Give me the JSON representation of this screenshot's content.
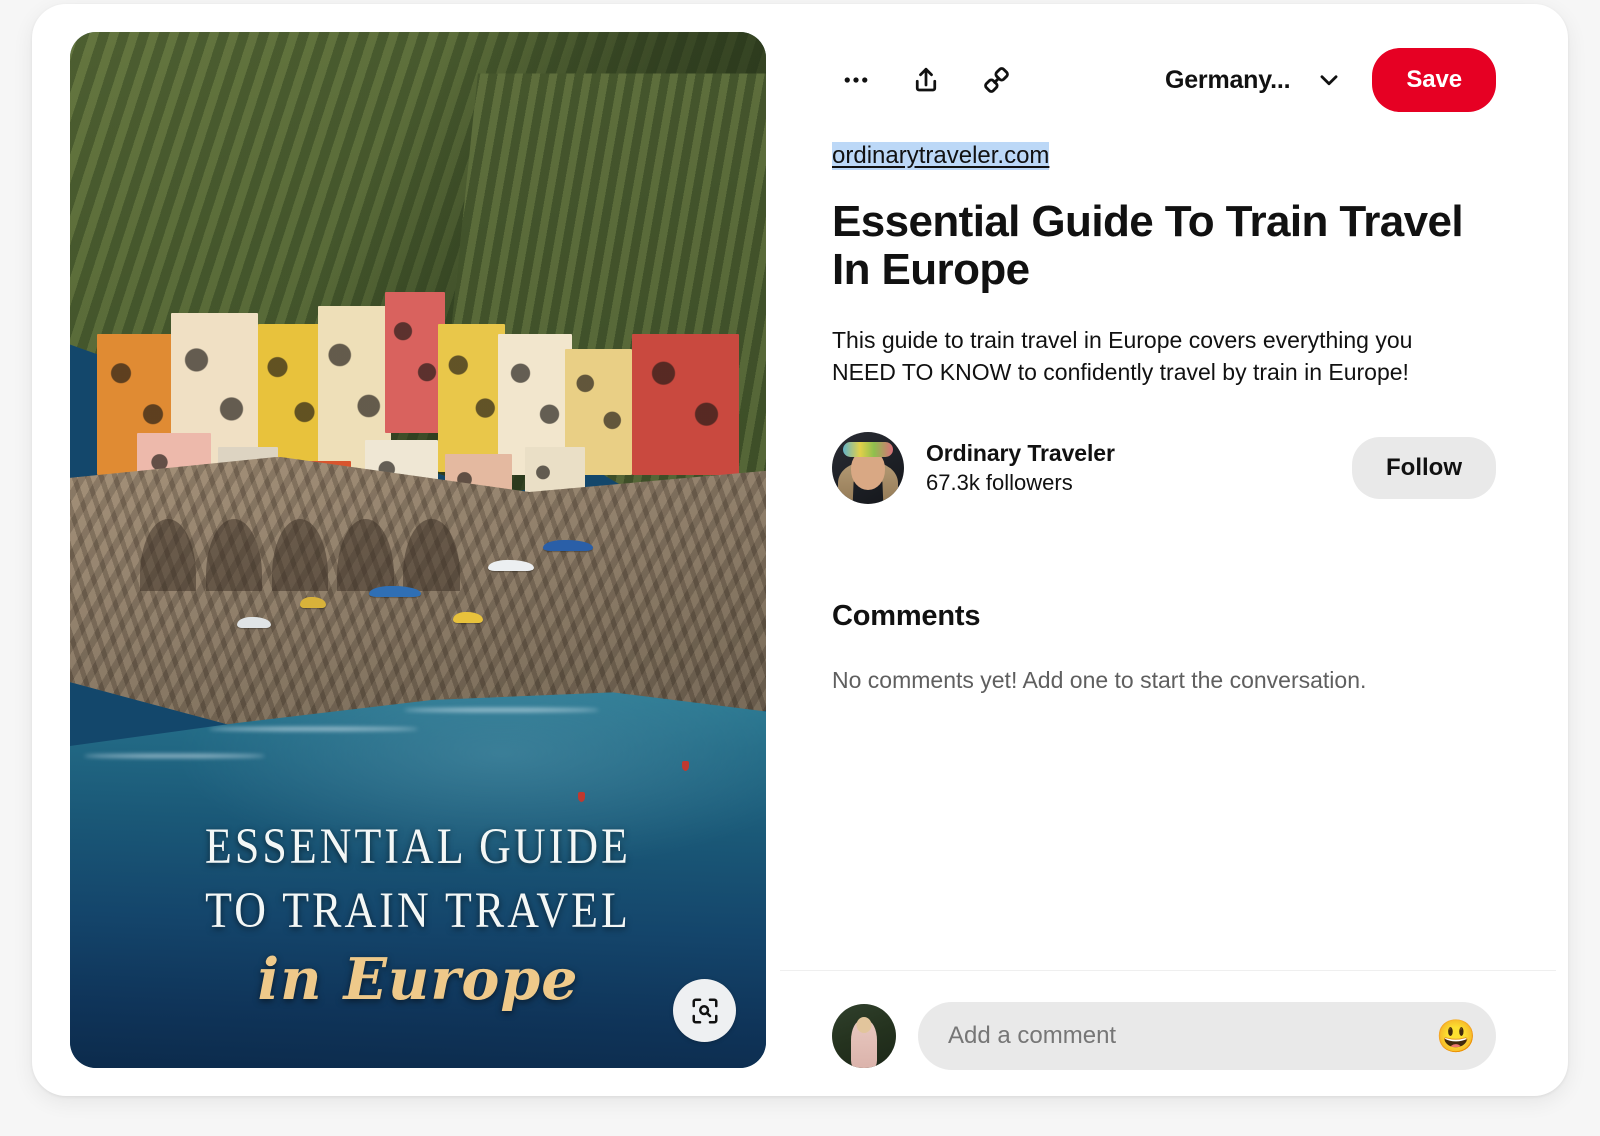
{
  "pin": {
    "source_url": "ordinarytraveler.com",
    "title": "Essential Guide To Train Travel In Europe",
    "description": "This guide to train travel in Europe covers everything you NEED TO KNOW to confidently travel by train in Europe!",
    "image_overlay": {
      "line1": "ESSENTIAL GUIDE",
      "line2": "TO TRAIN TRAVEL",
      "line3": "in Europe"
    }
  },
  "actions": {
    "more_options_icon": "ellipsis-icon",
    "share_icon": "share-upload-icon",
    "link_icon": "chain-link-icon",
    "board_name": "Germany...",
    "board_chevron_icon": "chevron-down-icon",
    "save_label": "Save",
    "save_color": "#e60023",
    "visual_search_icon": "lens-search-icon"
  },
  "author": {
    "name": "Ordinary Traveler",
    "followers": "67.3k followers",
    "follow_label": "Follow",
    "avatar_name": "author-avatar"
  },
  "comments": {
    "heading": "Comments",
    "empty_text": "No comments yet! Add one to start the conversation.",
    "composer": {
      "placeholder": "Add a comment",
      "value": "",
      "emoji_icon": "grinning-face-emoji",
      "emoji_glyph": "😃",
      "avatar_name": "current-user-avatar"
    }
  },
  "theme": {
    "page_background": "#f6f6f6",
    "card_background": "#ffffff",
    "accent_red": "#e60023",
    "muted_grey": "#e9e9e9",
    "link_highlight": "#bcd8f7",
    "text_primary": "#111111",
    "text_secondary": "#5f5f5f"
  }
}
